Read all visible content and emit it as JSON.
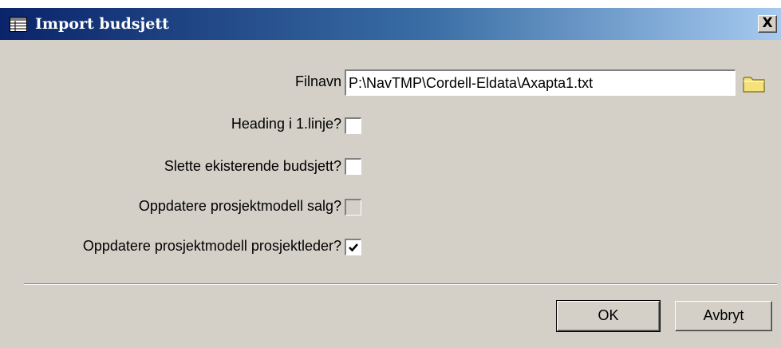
{
  "window": {
    "title": "Import budsjett",
    "icon": "table-icon",
    "close_label": "X"
  },
  "form": {
    "filename": {
      "label": "Filnavn",
      "value": "P:\\NavTMP\\Cordell-Eldata\\Axapta1.txt",
      "browse_icon": "folder-icon"
    },
    "heading_first_line": {
      "label": "Heading i 1.linje?",
      "checked": false,
      "enabled": true
    },
    "delete_existing": {
      "label": "Slette ekisterende budsjett?",
      "checked": false,
      "enabled": true
    },
    "update_sales_model": {
      "label": "Oppdatere prosjektmodell salg?",
      "checked": false,
      "enabled": false
    },
    "update_pm_model": {
      "label": "Oppdatere prosjektmodell prosjektleder?",
      "checked": true,
      "enabled": true
    }
  },
  "buttons": {
    "ok": "OK",
    "cancel": "Avbryt"
  },
  "colors": {
    "titlebar_start": "#0a246a",
    "titlebar_end": "#a6caf0",
    "dialog_bg": "#d4d0c8"
  }
}
